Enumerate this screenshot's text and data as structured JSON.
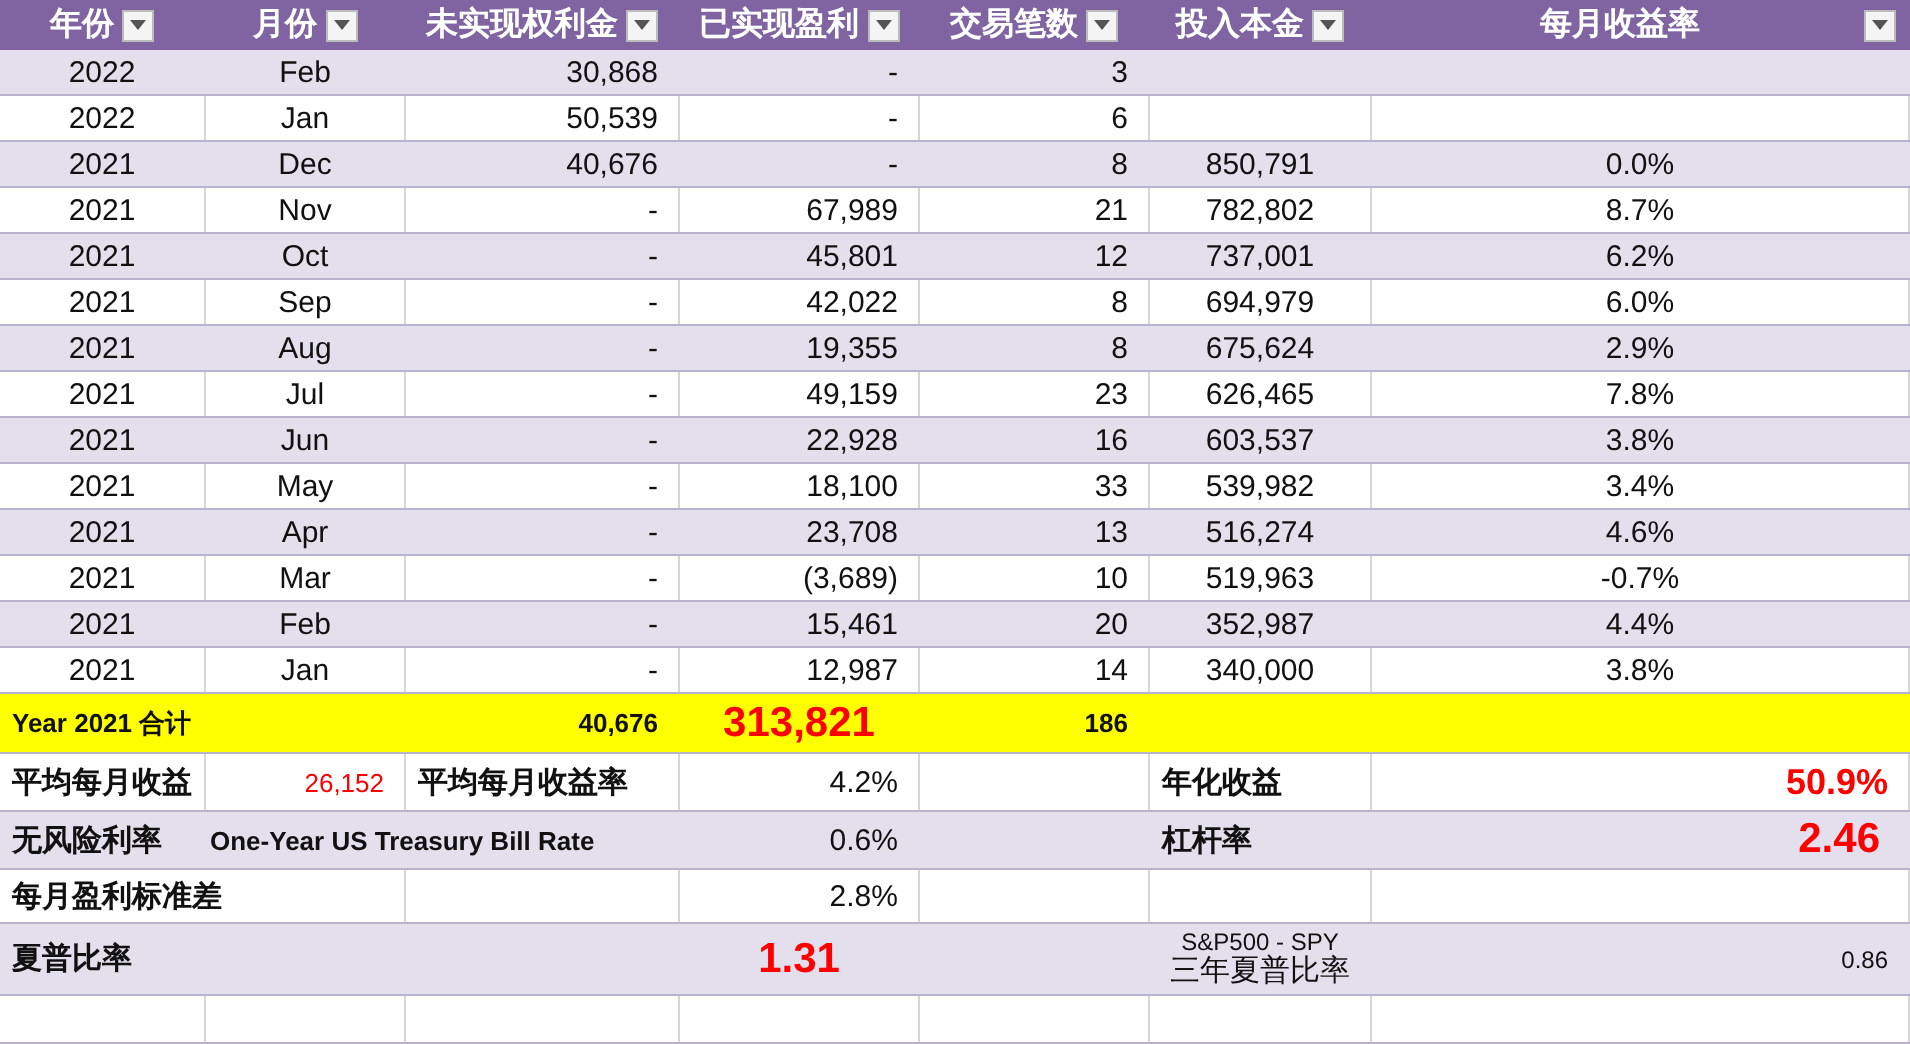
{
  "table": {
    "columns": [
      {
        "label": "年份"
      },
      {
        "label": "月份"
      },
      {
        "label": "未实现权利金"
      },
      {
        "label": "已实现盈利"
      },
      {
        "label": "交易笔数"
      },
      {
        "label": "投入本金"
      },
      {
        "label": "每月收益率"
      }
    ],
    "rows": [
      {
        "year": "2022",
        "month": "Feb",
        "unrealized": "30,868",
        "realized": "-",
        "trades": "3"
      },
      {
        "year": "2022",
        "month": "Jan",
        "unrealized": "50,539",
        "realized": "-",
        "trades": "6"
      },
      {
        "year": "2021",
        "month": "Dec",
        "unrealized": "40,676",
        "realized": "-",
        "trades": "8",
        "principal": "850,791",
        "monthly_return": "0.0%"
      },
      {
        "year": "2021",
        "month": "Nov",
        "unrealized": "-",
        "realized": "67,989",
        "trades": "21",
        "principal": "782,802",
        "monthly_return": "8.7%"
      },
      {
        "year": "2021",
        "month": "Oct",
        "unrealized": "-",
        "realized": "45,801",
        "trades": "12",
        "principal": "737,001",
        "monthly_return": "6.2%"
      },
      {
        "year": "2021",
        "month": "Sep",
        "unrealized": "-",
        "realized": "42,022",
        "trades": "8",
        "principal": "694,979",
        "monthly_return": "6.0%"
      },
      {
        "year": "2021",
        "month": "Aug",
        "unrealized": "-",
        "realized": "19,355",
        "trades": "8",
        "principal": "675,624",
        "monthly_return": "2.9%"
      },
      {
        "year": "2021",
        "month": "Jul",
        "unrealized": "-",
        "realized": "49,159",
        "trades": "23",
        "principal": "626,465",
        "monthly_return": "7.8%"
      },
      {
        "year": "2021",
        "month": "Jun",
        "unrealized": "-",
        "realized": "22,928",
        "trades": "16",
        "principal": "603,537",
        "monthly_return": "3.8%"
      },
      {
        "year": "2021",
        "month": "May",
        "unrealized": "-",
        "realized": "18,100",
        "trades": "33",
        "principal": "539,982",
        "monthly_return": "3.4%"
      },
      {
        "year": "2021",
        "month": "Apr",
        "unrealized": "-",
        "realized": "23,708",
        "trades": "13",
        "principal": "516,274",
        "monthly_return": "4.6%"
      },
      {
        "year": "2021",
        "month": "Mar",
        "unrealized": "-",
        "realized": "(3,689)",
        "trades": "10",
        "principal": "519,963",
        "monthly_return": "-0.7%"
      },
      {
        "year": "2021",
        "month": "Feb",
        "unrealized": "-",
        "realized": "15,461",
        "trades": "20",
        "principal": "352,987",
        "monthly_return": "4.4%"
      },
      {
        "year": "2021",
        "month": "Jan",
        "unrealized": "-",
        "realized": "12,987",
        "trades": "14",
        "principal": "340,000",
        "monthly_return": "3.8%"
      }
    ],
    "total_row": {
      "label": "Year 2021 合计",
      "unrealized": "40,676",
      "realized": "313,821",
      "trades": "186"
    }
  },
  "summary": {
    "avg_monthly_profit": {
      "label": "平均每月收益",
      "value": "26,152"
    },
    "avg_monthly_return": {
      "label": "平均每月收益率",
      "value": "4.2%"
    },
    "annualized_return": {
      "label": "年化收益",
      "value": "50.9%"
    },
    "risk_free_rate": {
      "label": "无风险利率",
      "note": "One-Year US Treasury Bill Rate",
      "value": "0.6%"
    },
    "leverage": {
      "label": "杠杆率",
      "value": "2.46"
    },
    "monthly_std": {
      "label": "每月盈利标准差",
      "value": "2.8%"
    },
    "sharpe": {
      "label": "夏普比率",
      "value": "1.31"
    },
    "benchmark": {
      "name": "S&P500 - SPY",
      "label": "三年夏普比率",
      "value": "0.86"
    }
  }
}
